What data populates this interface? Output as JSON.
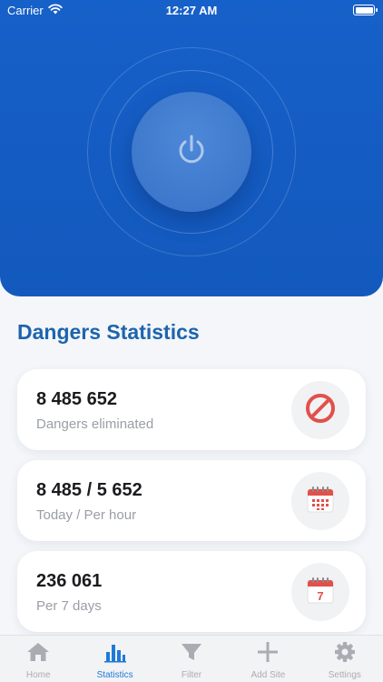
{
  "status_bar": {
    "carrier": "Carrier",
    "time": "12:27 AM"
  },
  "hero": {
    "power_icon": "power-icon"
  },
  "stats": {
    "title": "Dangers Statistics",
    "cards": [
      {
        "value": "8 485 652",
        "label": "Dangers eliminated",
        "icon": "block-icon"
      },
      {
        "value": "8 485 / 5 652",
        "label": "Today / Per hour",
        "icon": "calendar-icon"
      },
      {
        "value": "236 061",
        "label": "Per 7 days",
        "icon": "calendar-7-icon",
        "icon_text": "7"
      }
    ]
  },
  "tabbar": {
    "active": "Statistics",
    "items": [
      {
        "label": "Home",
        "icon": "home-icon"
      },
      {
        "label": "Statistics",
        "icon": "bar-chart-icon"
      },
      {
        "label": "Filter",
        "icon": "filter-icon"
      },
      {
        "label": "Add Site",
        "icon": "plus-icon"
      },
      {
        "label": "Settings",
        "icon": "gear-icon"
      }
    ]
  },
  "colors": {
    "hero_blue": "#1660c9",
    "title_blue": "#1d64ae",
    "danger_red": "#e2504a",
    "tab_active": "#1f7ad6",
    "tab_inactive": "#a9adb3"
  }
}
